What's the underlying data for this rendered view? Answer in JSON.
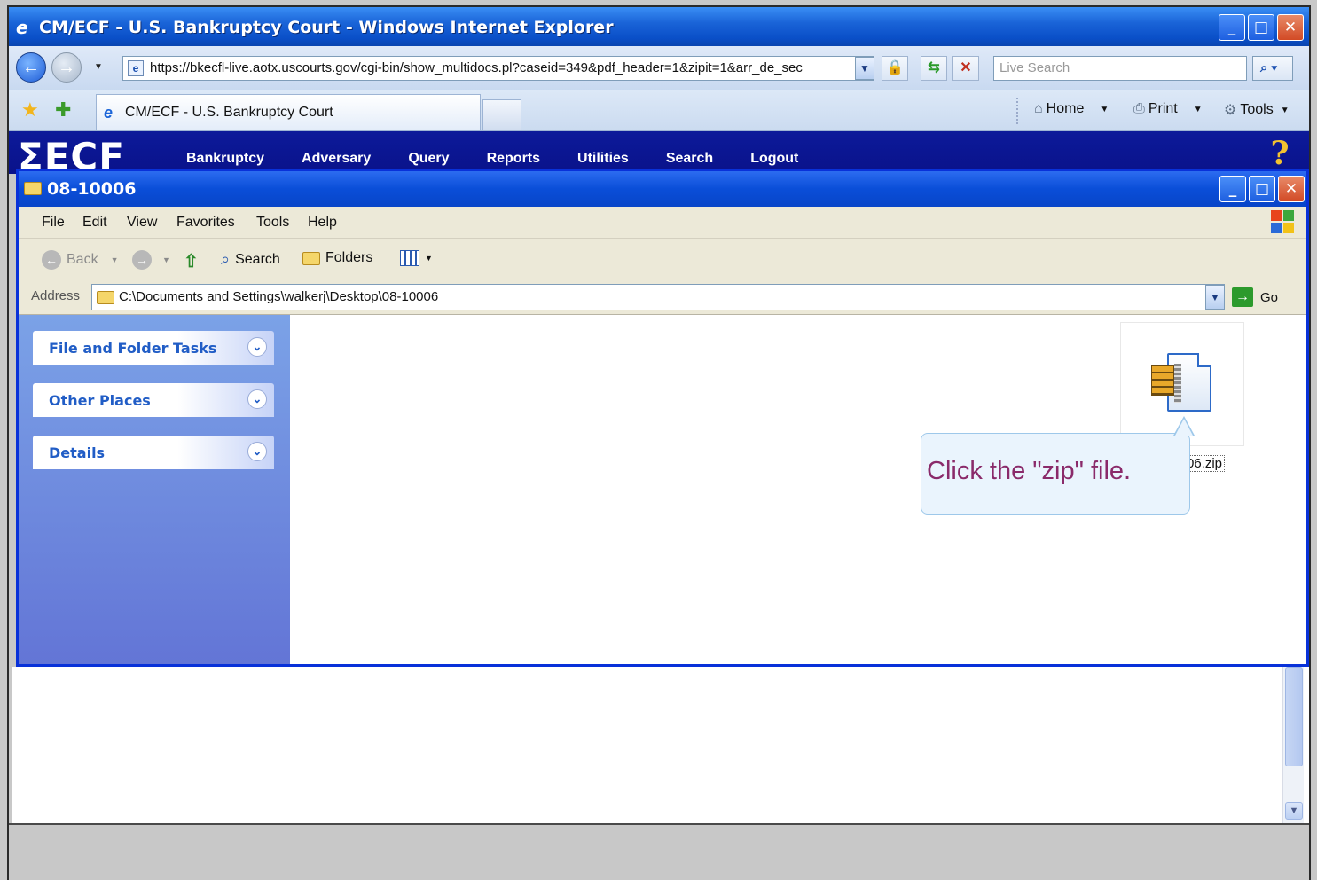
{
  "ie": {
    "title": "CM/ECF - U.S. Bankruptcy Court - Windows Internet Explorer",
    "url": "https://bkecfl-live.aotx.uscourts.gov/cgi-bin/show_multidocs.pl?caseid=349&pdf_header=1&zipit=1&arr_de_sec",
    "search_placeholder": "Live Search",
    "tab_title": "CM/ECF - U.S. Bankruptcy Court",
    "cmd_home": "Home",
    "cmd_print": "Print",
    "cmd_tools": "Tools"
  },
  "ecf": {
    "logo": "ECF",
    "menu": [
      "Bankruptcy",
      "Adversary",
      "Query",
      "Reports",
      "Utilities",
      "Search",
      "Logout"
    ],
    "help_glyph": "?"
  },
  "explorer": {
    "title": "08-10006",
    "menu": [
      "File",
      "Edit",
      "View",
      "Favorites",
      "Tools",
      "Help"
    ],
    "toolbar": {
      "back": "Back",
      "search": "Search",
      "folders": "Folders"
    },
    "address_label": "Address",
    "address_value": "C:\\Documents and Settings\\walkerj\\Desktop\\08-10006",
    "go_label": "Go",
    "tasks": [
      "File and Folder Tasks",
      "Other Places",
      "Details"
    ],
    "file_name": "06.zip"
  },
  "callout": {
    "text": "Click the \"zip\" file."
  },
  "colors": {
    "xp_blue": "#0a4ed8",
    "ecf_navy": "#0a128a",
    "callout_text": "#8a2a6a",
    "task_text": "#215dc6"
  }
}
